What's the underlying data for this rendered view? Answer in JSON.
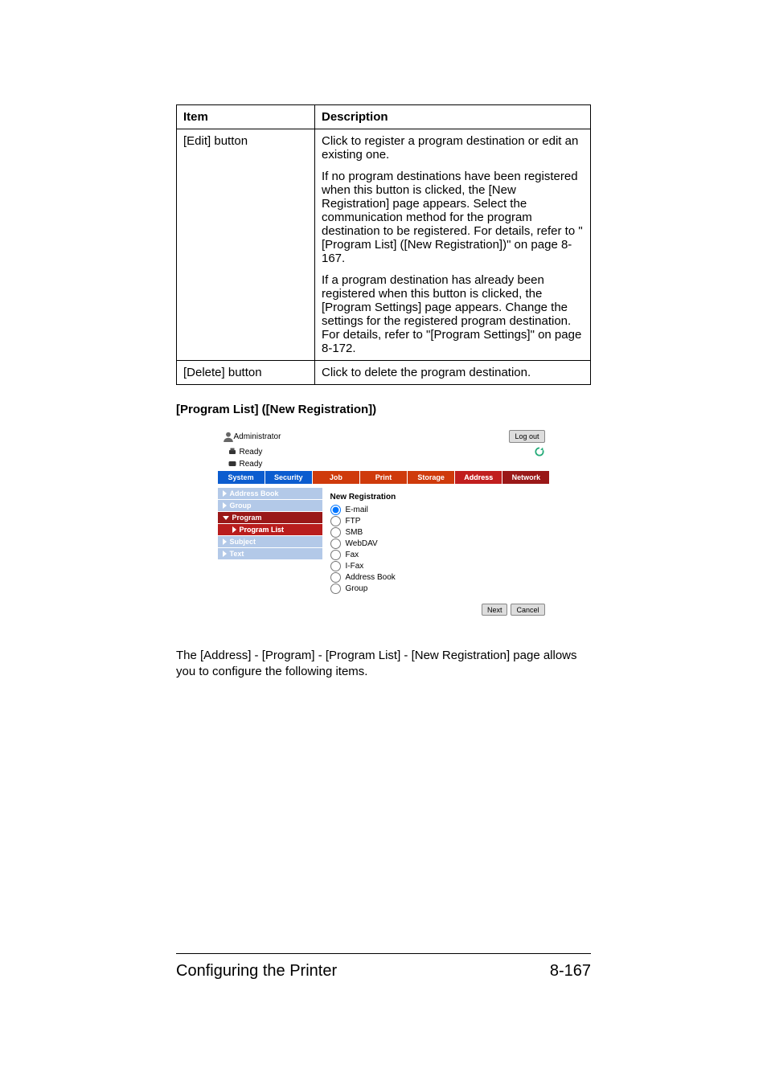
{
  "table": {
    "head_item": "Item",
    "head_desc": "Description",
    "rows": [
      {
        "item": "[Edit] button",
        "blocks": [
          "Click to register a program destination or edit an existing one.",
          "If no program destinations have been registered when this button is clicked, the [New Registration] page appears. Select the communication method for the program destination to be registered. For details, refer to \"[Program List] ([New Registration])\" on page 8-167.",
          "If a program destination has already been registered when this button is clicked, the [Program Settings] page appears. Change the settings for the registered program destination. For details, refer to \"[Program Settings]\" on page 8-172."
        ]
      },
      {
        "item": "[Delete] button",
        "blocks": [
          "Click to delete the program destination."
        ]
      }
    ]
  },
  "section_title": "[Program List] ([New Registration])",
  "screenshot": {
    "admin_label": "Administrator",
    "logout": "Log out",
    "status1": "Ready",
    "status2": "Ready",
    "tabs": [
      "System",
      "Security",
      "Job",
      "Print",
      "Storage",
      "Address",
      "Network"
    ],
    "sidebar": [
      {
        "label": "Address Book",
        "type": "pale",
        "arrow": "right"
      },
      {
        "label": "Group",
        "type": "pale",
        "arrow": "right"
      },
      {
        "label": "Program",
        "type": "red",
        "arrow": "down"
      },
      {
        "label": "Program List",
        "type": "redpale",
        "arrow": "right"
      },
      {
        "label": "Subject",
        "type": "pale",
        "arrow": "right"
      },
      {
        "label": "Text",
        "type": "pale",
        "arrow": "right"
      }
    ],
    "panel_title": "New Registration",
    "options": [
      {
        "label": "E-mail",
        "checked": true
      },
      {
        "label": "FTP",
        "checked": false
      },
      {
        "label": "SMB",
        "checked": false
      },
      {
        "label": "WebDAV",
        "checked": false
      },
      {
        "label": "Fax",
        "checked": false
      },
      {
        "label": "I-Fax",
        "checked": false
      },
      {
        "label": "Address Book",
        "checked": false
      },
      {
        "label": "Group",
        "checked": false
      }
    ],
    "next": "Next",
    "cancel": "Cancel"
  },
  "caption": "The [Address] - [Program] - [Program List] - [New Registration] page allows you to configure the following items.",
  "footer_left": "Configuring the Printer",
  "footer_right": "8-167"
}
